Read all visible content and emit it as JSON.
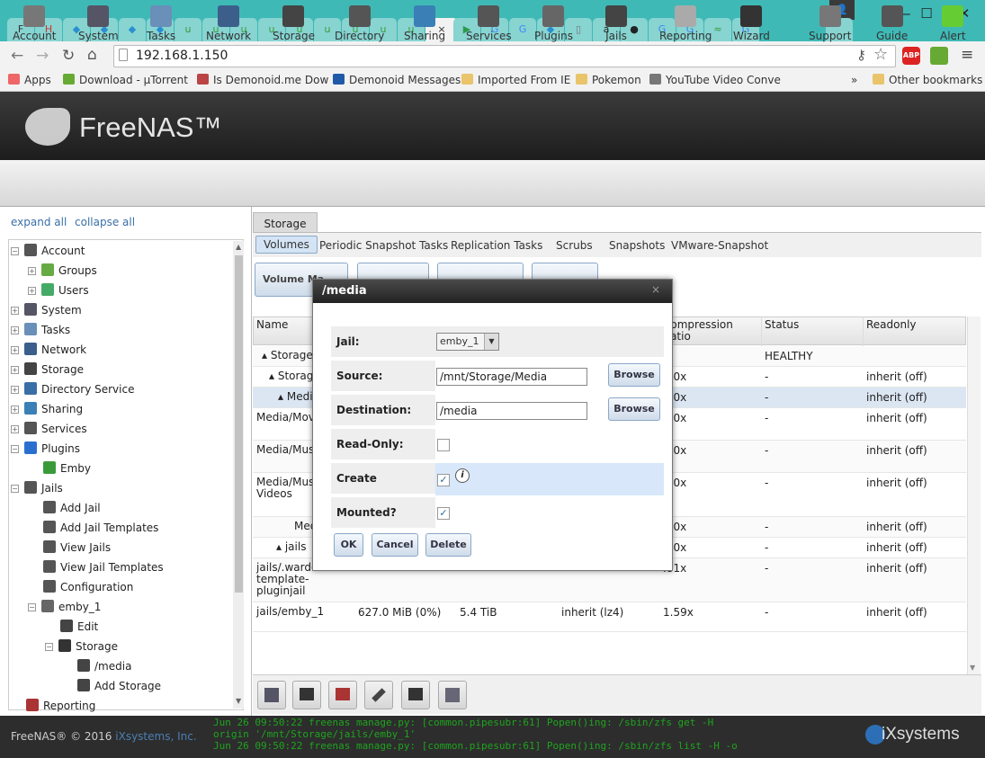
{
  "browser": {
    "url": "192.168.1.150",
    "tabs": [
      {
        "label": "F",
        "color": "#333"
      },
      {
        "label": "H",
        "color": "#c33"
      },
      {
        "label": "◆",
        "color": "#2a8fd0"
      },
      {
        "label": "◆",
        "color": "#2a8fd0"
      },
      {
        "label": "◆",
        "color": "#2a8fd0"
      },
      {
        "label": "◆",
        "color": "#2a8fd0"
      },
      {
        "label": "u",
        "color": "#3a9a3a"
      },
      {
        "label": "u",
        "color": "#3a9a3a"
      },
      {
        "label": "u",
        "color": "#3a9a3a"
      },
      {
        "label": "u",
        "color": "#3a9a3a"
      },
      {
        "label": "u",
        "color": "#3a9a3a"
      },
      {
        "label": "u",
        "color": "#3a9a3a"
      },
      {
        "label": "u",
        "color": "#3a9a3a"
      },
      {
        "label": "u",
        "color": "#3a9a3a"
      },
      {
        "label": "u",
        "color": "#3a9a3a"
      },
      {
        "label": "×",
        "color": "#333",
        "active": true
      },
      {
        "label": "▶",
        "color": "#2a9a4a"
      },
      {
        "label": "G",
        "color": "#4285f4"
      },
      {
        "label": "G",
        "color": "#4285f4"
      },
      {
        "label": "◆",
        "color": "#2a8fd0"
      },
      {
        "label": "▯",
        "color": "#777"
      },
      {
        "label": "a",
        "color": "#222"
      },
      {
        "label": "●",
        "color": "#222"
      },
      {
        "label": "G",
        "color": "#4285f4"
      },
      {
        "label": "G",
        "color": "#4285f4"
      },
      {
        "label": "≈",
        "color": "#3a9a3a"
      },
      {
        "label": "G",
        "color": "#4285f4"
      }
    ],
    "bookmarks": [
      {
        "label": "Apps",
        "color": "#e66"
      },
      {
        "label": "Download - µTorrent",
        "color": "#6a3"
      },
      {
        "label": "Is Demonoid.me Dow",
        "color": "#b44"
      },
      {
        "label": "Demonoid Messages",
        "color": "#1f5aa8"
      },
      {
        "label": "Imported From IE",
        "color": "#e9c46a"
      },
      {
        "label": "Pokemon",
        "color": "#e9c46a"
      },
      {
        "label": "YouTube Video Conve",
        "color": "#777"
      }
    ],
    "bookmarks_more": "»",
    "other_bookmarks": "Other bookmarks"
  },
  "app": {
    "logo": "FreeNAS™",
    "toolbar": [
      "Account",
      "System",
      "Tasks",
      "Network",
      "Storage",
      "Directory",
      "Sharing",
      "Services",
      "Plugins",
      "Jails",
      "Reporting",
      "Wizard",
      "Support",
      "Guide",
      "Alert"
    ],
    "expand_all": "expand all",
    "collapse_all": "collapse all"
  },
  "tree": [
    {
      "label": "Account",
      "indent": 0,
      "exp": "−"
    },
    {
      "label": "Groups",
      "indent": 1,
      "exp": "+"
    },
    {
      "label": "Users",
      "indent": 1,
      "exp": "+"
    },
    {
      "label": "System",
      "indent": 0,
      "exp": "+"
    },
    {
      "label": "Tasks",
      "indent": 0,
      "exp": "+"
    },
    {
      "label": "Network",
      "indent": 0,
      "exp": "+"
    },
    {
      "label": "Storage",
      "indent": 0,
      "exp": "+"
    },
    {
      "label": "Directory Service",
      "indent": 0,
      "exp": "+"
    },
    {
      "label": "Sharing",
      "indent": 0,
      "exp": "+"
    },
    {
      "label": "Services",
      "indent": 0,
      "exp": "+"
    },
    {
      "label": "Plugins",
      "indent": 0,
      "exp": "−"
    },
    {
      "label": "Emby",
      "indent": 1,
      "exp": ""
    },
    {
      "label": "Jails",
      "indent": 0,
      "exp": "−"
    },
    {
      "label": "Add Jail",
      "indent": 1,
      "exp": ""
    },
    {
      "label": "Add Jail Templates",
      "indent": 1,
      "exp": ""
    },
    {
      "label": "View Jails",
      "indent": 1,
      "exp": ""
    },
    {
      "label": "View Jail Templates",
      "indent": 1,
      "exp": ""
    },
    {
      "label": "Configuration",
      "indent": 1,
      "exp": ""
    },
    {
      "label": "emby_1",
      "indent": 1,
      "exp": "−"
    },
    {
      "label": "Edit",
      "indent": 2,
      "exp": ""
    },
    {
      "label": "Storage",
      "indent": 2,
      "exp": "−"
    },
    {
      "label": "/media",
      "indent": 3,
      "exp": ""
    },
    {
      "label": "Add Storage",
      "indent": 3,
      "exp": ""
    },
    {
      "label": "Reporting",
      "indent": 0,
      "exp": ""
    }
  ],
  "storage": {
    "main_tab": "Storage",
    "subtabs": [
      "Volumes",
      "Periodic Snapshot Tasks",
      "Replication Tasks",
      "Scrubs",
      "Snapshots",
      "VMware-Snapshot"
    ],
    "action_buttons": [
      "Volume Ma...",
      "...",
      "...",
      "..."
    ],
    "columns": [
      "Name",
      "",
      "",
      "",
      "Compression Ratio",
      "Status",
      "Readonly"
    ],
    "rows": [
      {
        "name": "▴ Storage",
        "c2": "",
        "c3": "",
        "c4": "",
        "ratio": "",
        "status": "HEALTHY",
        "ro": ""
      },
      {
        "name": "▴ Storag",
        "c2": "",
        "c3": "",
        "c4": "",
        "ratio": ".00x",
        "status": "-",
        "ro": "inherit (off)"
      },
      {
        "name": "▴ Medi",
        "c2": "",
        "c3": "",
        "c4": "",
        "ratio": ".00x",
        "status": "-",
        "ro": "inherit (off)"
      },
      {
        "name": "Media/Mov",
        "c2": "",
        "c3": "",
        "c4": "",
        "ratio": ".00x",
        "status": "-",
        "ro": "inherit (off)"
      },
      {
        "name": "Media/Musi",
        "c2": "",
        "c3": "",
        "c4": "",
        "ratio": ".00x",
        "status": "-",
        "ro": "inherit (off)"
      },
      {
        "name": "Media/Musi Videos",
        "c2": "",
        "c3": "",
        "c4": "",
        "ratio": ".00x",
        "status": "-",
        "ro": "inherit (off)"
      },
      {
        "name": "Med",
        "c2": "",
        "c3": "",
        "c4": "",
        "ratio": ".00x",
        "status": "-",
        "ro": "inherit (off)"
      },
      {
        "name": "▴ jails",
        "c2": "",
        "c3": "",
        "c4": "",
        "ratio": ".70x",
        "status": "-",
        "ro": "inherit (off)"
      },
      {
        "name": "jails/.warden-template-pluginjail",
        "c2": "",
        "c3": "",
        "c4": "",
        "ratio": ".81x",
        "status": "-",
        "ro": "inherit (off)"
      },
      {
        "name": "jails/emby_1",
        "c2": "627.0 MiB (0%)",
        "c3": "5.4 TiB",
        "c4": "inherit (lz4)",
        "ratio": "1.59x",
        "status": "-",
        "ro": "inherit (off)"
      }
    ]
  },
  "dialog": {
    "title": "/media",
    "close": "×",
    "jail_label": "Jail:",
    "jail_value": "emby_1",
    "source_label": "Source:",
    "source_value": "/mnt/Storage/Media",
    "destination_label": "Destination:",
    "destination_value": "/media",
    "browse": "Browse",
    "readonly_label": "Read-Only:",
    "readonly_checked": false,
    "create_dir_label": "Create directory:",
    "create_dir_checked": true,
    "mounted_label": "Mounted?",
    "mounted_checked": true,
    "ok": "OK",
    "cancel": "Cancel",
    "delete": "Delete"
  },
  "footer": {
    "copyright": "FreeNAS® © 2016",
    "company": "iXsystems, Inc.",
    "brand": "iXsystems",
    "log": [
      "Jun 26 09:50:22 freenas manage.py: [common.pipesubr:61] Popen()ing: /sbin/zfs get -H",
      "origin '/mnt/Storage/jails/emby_1'",
      "Jun 26 09:50:22 freenas manage.py: [common.pipesubr:61] Popen()ing: /sbin/zfs list -H -o"
    ]
  }
}
